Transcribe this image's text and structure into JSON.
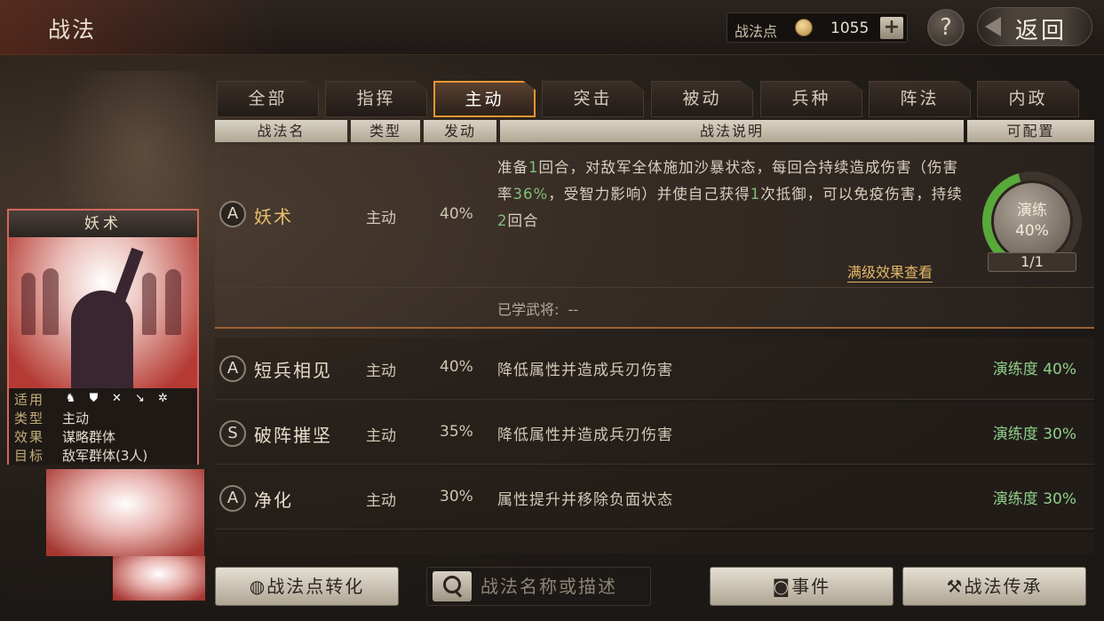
{
  "header": {
    "title": "战法",
    "points_label": "战法点",
    "points_value": "1055",
    "plus": "+",
    "help": "?",
    "back_label": "返回"
  },
  "tabs": [
    {
      "label": "全部",
      "active": false
    },
    {
      "label": "指挥",
      "active": false
    },
    {
      "label": "主动",
      "active": true
    },
    {
      "label": "突击",
      "active": false
    },
    {
      "label": "被动",
      "active": false
    },
    {
      "label": "兵种",
      "active": false
    },
    {
      "label": "阵法",
      "active": false
    },
    {
      "label": "内政",
      "active": false
    }
  ],
  "columns": {
    "name": "战法名",
    "type": "类型",
    "trigger": "发动",
    "desc": "战法说明",
    "config": "可配置"
  },
  "selected": {
    "grade": "A",
    "name": "妖术",
    "type": "主动",
    "pct": "40%",
    "desc_parts": [
      "准备",
      "1",
      "回合，对敌军全体施加沙暴状态，每回合持续造成伤害（伤害率",
      "36%",
      "，受智力影响）并使自己获得",
      "1",
      "次抵御，可以免疫伤害，持续",
      "2",
      "回合"
    ],
    "full_effect_link": "满级效果查看",
    "learned_label": "已学武将:",
    "learned_value": "--",
    "drill_label": "演练",
    "drill_pct": "40%",
    "drill_progress": 0.4,
    "slots": "1/1"
  },
  "rows": [
    {
      "grade": "A",
      "name": "短兵相见",
      "type": "主动",
      "pct": "40%",
      "desc": "降低属性并造成兵刃伤害",
      "prof": "演练度 40%"
    },
    {
      "grade": "S",
      "name": "破阵摧坚",
      "type": "主动",
      "pct": "35%",
      "desc": "降低属性并造成兵刃伤害",
      "prof": "演练度 30%"
    },
    {
      "grade": "A",
      "name": "净化",
      "type": "主动",
      "pct": "30%",
      "desc": "属性提升并移除负面状态",
      "prof": "演练度 30%"
    }
  ],
  "card": {
    "title": "妖术",
    "apply_label": "适用",
    "type_label": "类型",
    "type_value": "主动",
    "effect_label": "效果",
    "effect_value": "谋略群体",
    "target_label": "目标",
    "target_value": "敌军群体(3人)",
    "apply_icons": [
      "cavalry-icon",
      "shield-icon",
      "archer-icon",
      "spear-icon",
      "siege-icon"
    ]
  },
  "bottom": {
    "convert_label": "战法点转化",
    "search_placeholder": "战法名称或描述",
    "event_label": "事件",
    "inherit_label": "战法传承"
  },
  "colors": {
    "accent": "#e8962f",
    "gold_text": "#e3b765",
    "green_text": "#8fcf8a"
  }
}
